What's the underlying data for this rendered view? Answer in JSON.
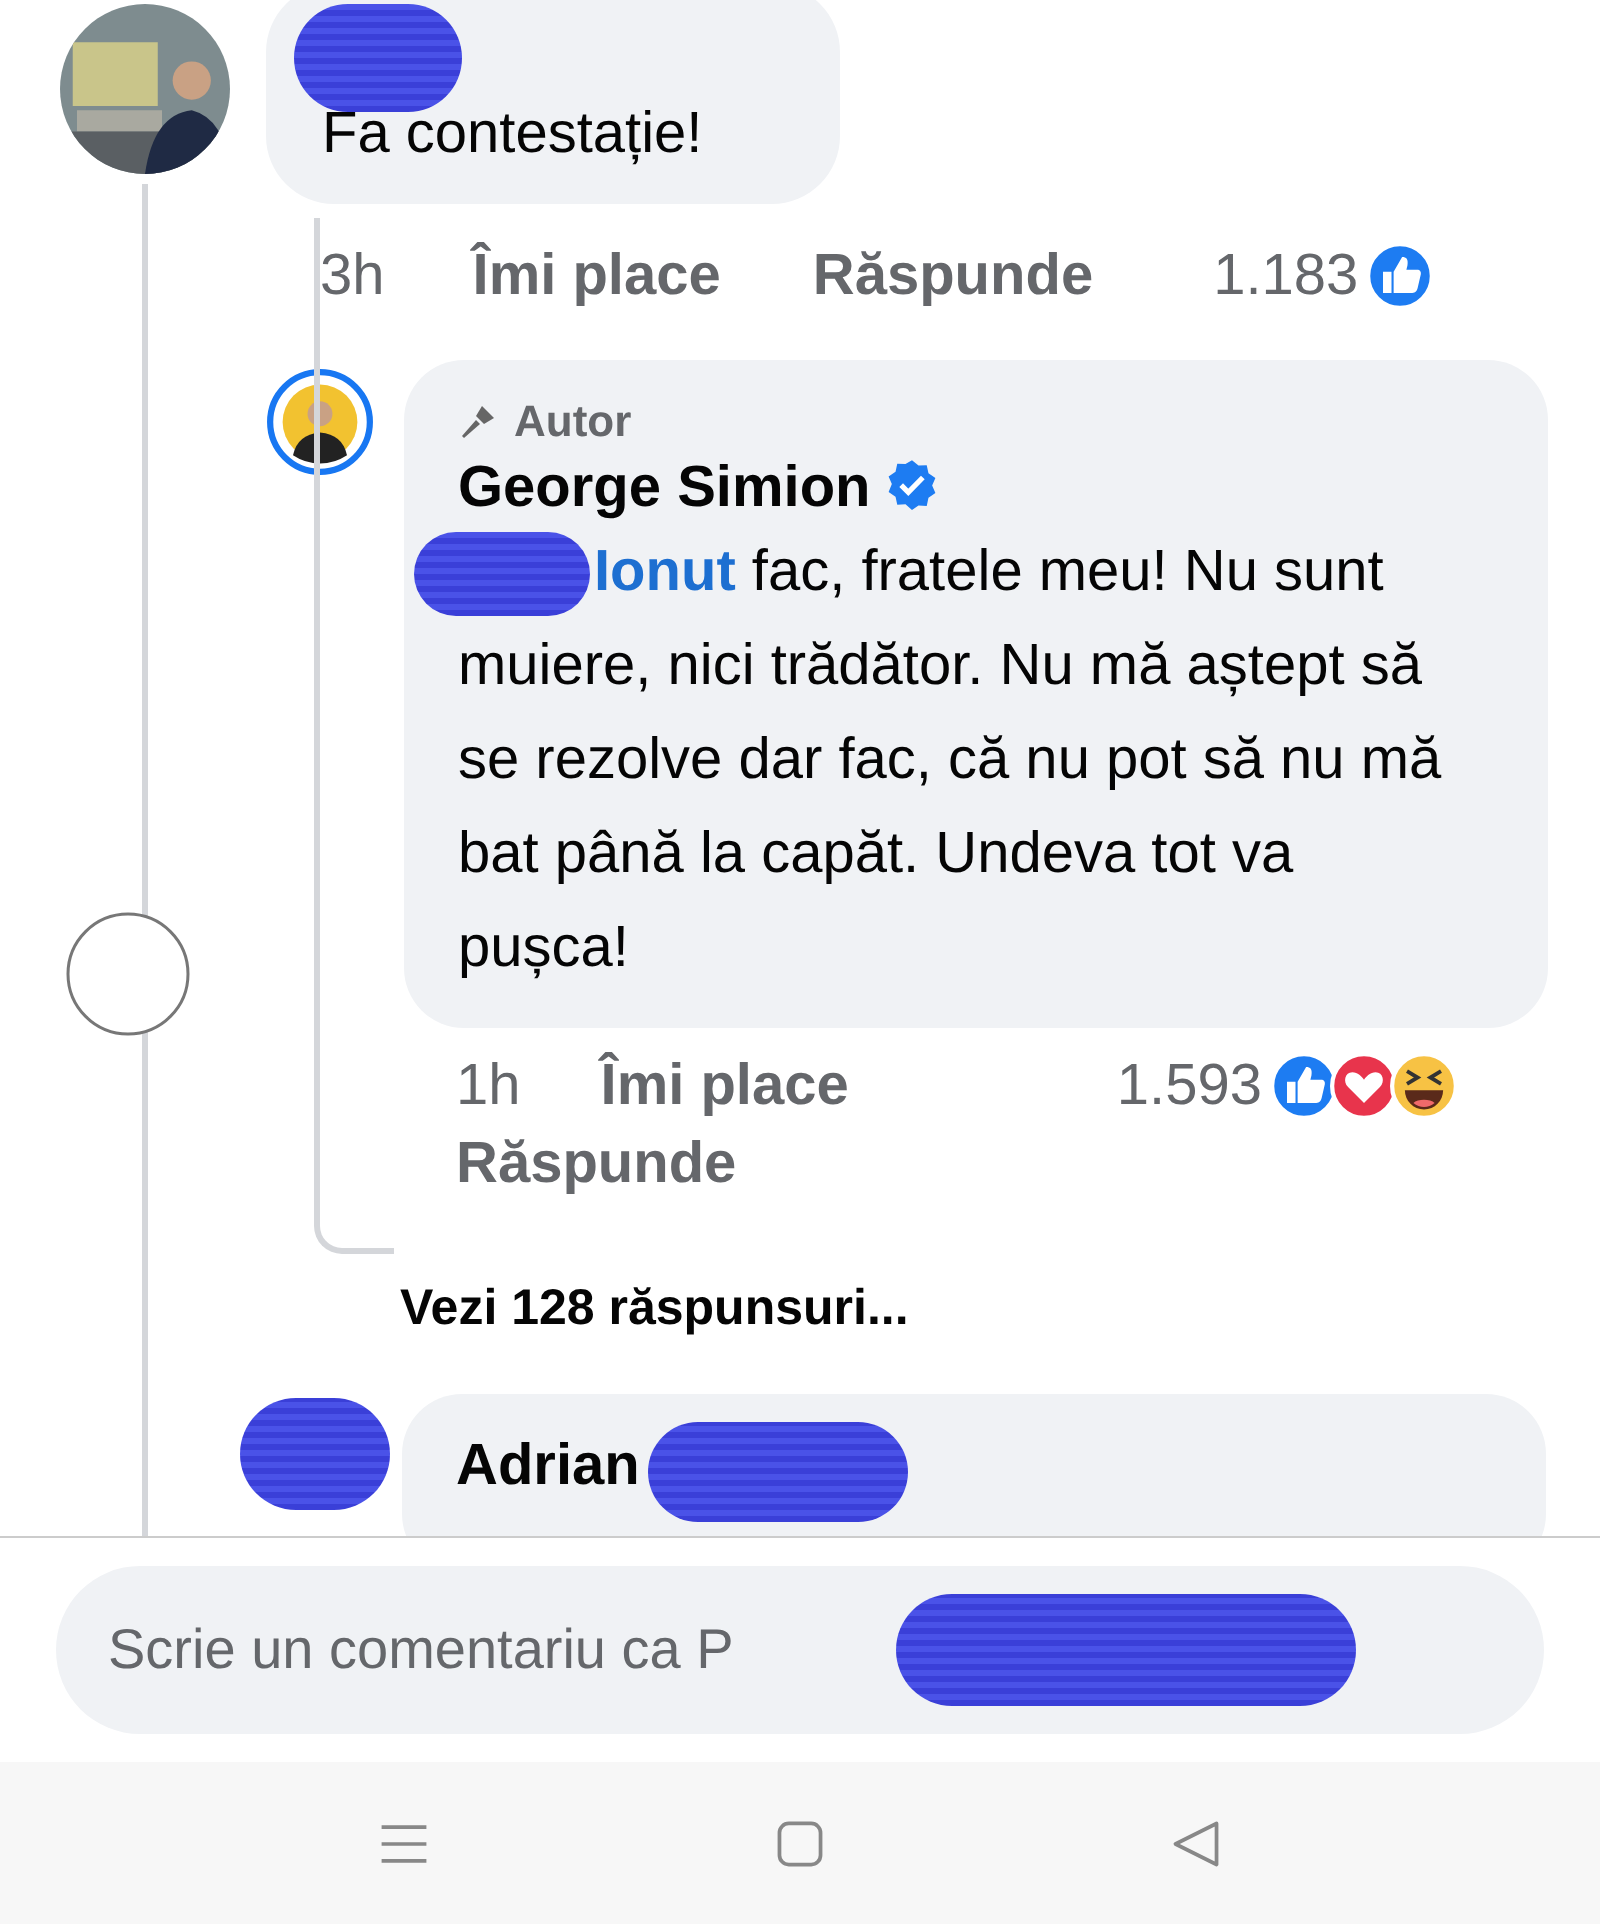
{
  "comment": {
    "text": "Fa contestație!",
    "time": "3h",
    "like_label": "Îmi place",
    "reply_label": "Răspunde",
    "reaction_count": "1.183",
    "reactions": [
      {
        "kind": "like"
      }
    ]
  },
  "reply": {
    "badge": "Autor",
    "author": "George Simion",
    "verified": true,
    "mention": "Ionut",
    "text": " fac, fratele meu! Nu sunt muiere, nici trădător. Nu mă aștept să se rezolve dar fac, că nu pot să nu mă bat până la capăt. Undeva tot va pușca!",
    "time": "1h",
    "like_label": "Îmi place",
    "reply_label": "Răspunde",
    "reaction_count": "1.593",
    "reactions": [
      {
        "kind": "like"
      },
      {
        "kind": "love"
      },
      {
        "kind": "haha"
      }
    ]
  },
  "view_replies": "Vezi 128 răspunsuri...",
  "next_comment": {
    "author": "Adrian"
  },
  "composer": {
    "placeholder": "Scrie un comentariu ca P"
  }
}
